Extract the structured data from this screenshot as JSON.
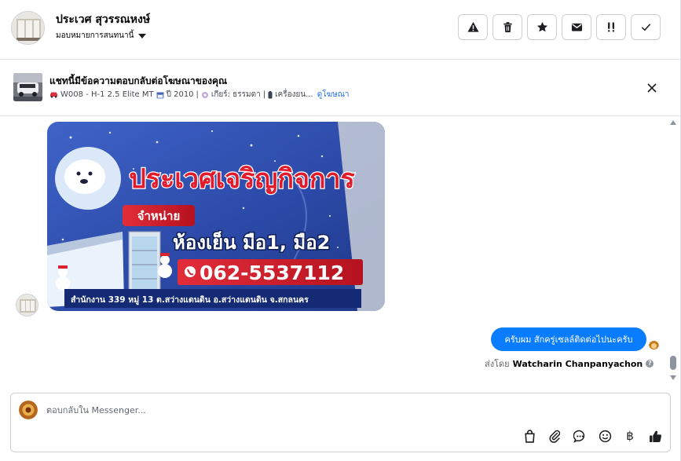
{
  "header": {
    "contact_name": "ประเวศ สุวรรณหงษ์",
    "assignee_label": "มอบหมายการสนทนานี้",
    "actions": [
      {
        "icon": "warning-icon"
      },
      {
        "icon": "trash-icon"
      },
      {
        "icon": "star-icon"
      },
      {
        "icon": "envelope-icon"
      },
      {
        "icon": "follow-up-icon"
      },
      {
        "icon": "check-icon"
      }
    ]
  },
  "ad": {
    "title": "แชทนี้มีข้อความตอบกลับต่อโฆษณาของคุณ",
    "meta_model": "W008 - H-1 2.5 Elite MT",
    "meta_year": "ปี 2010",
    "meta_gear": "เกียร์: ธรรมดา",
    "meta_engine": "เครื่องยน...",
    "view_ad_link": "ดูโฆษณา"
  },
  "photo": {
    "headline": "ประเวศเจริญกิจการ",
    "tag": "จำหน่าย",
    "subline": "ห้องเย็น มือ1, มือ2",
    "phone": "062-5537112",
    "address": "สำนักงาน 339 หมู่ 13 ต.สว่างแดนดิน  อ.สว่างแดนดิน  จ.สกลนคร"
  },
  "messages": {
    "outgoing_text": "ครับผม สักครู่เซลล์ติดต่อไปนะครับ",
    "sent_by_prefix": "ส่งโดย",
    "sent_by_name": "Watcharin Chanpanyachon",
    "info_glyph": "?"
  },
  "composer": {
    "placeholder": "ตอบกลับใน Messenger...",
    "value": "",
    "tools": [
      "shopping-bag-icon",
      "paperclip-icon",
      "chat-bubble-icon",
      "emoji-icon",
      "baht-icon",
      "thumbs-up-icon"
    ],
    "baht_glyph": "฿"
  },
  "colors": {
    "accent": "#0a7cff",
    "link": "#216fdb",
    "border": "#dddfe2",
    "photo_banner_red": "#d8222f",
    "photo_banner_blue": "#1b3a8c"
  }
}
